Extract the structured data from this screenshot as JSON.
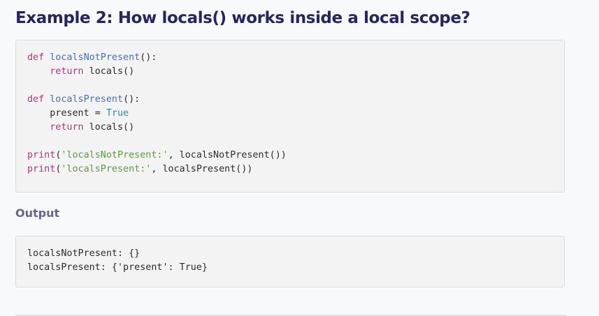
{
  "heading": {
    "title": "Example 2: How locals() works inside a local scope?"
  },
  "source_code": {
    "lines": [
      [
        {
          "t": "def ",
          "c": "kw"
        },
        {
          "t": "localsNotPresent",
          "c": "fn"
        },
        {
          "t": "():",
          "c": "pl"
        }
      ],
      [
        {
          "t": "    ",
          "c": "pl"
        },
        {
          "t": "return",
          "c": "kw"
        },
        {
          "t": " locals()",
          "c": "pl"
        }
      ],
      [],
      [
        {
          "t": "def ",
          "c": "kw"
        },
        {
          "t": "localsPresent",
          "c": "fn"
        },
        {
          "t": "():",
          "c": "pl"
        }
      ],
      [
        {
          "t": "    present = ",
          "c": "pl"
        },
        {
          "t": "True",
          "c": "bi"
        }
      ],
      [
        {
          "t": "    ",
          "c": "pl"
        },
        {
          "t": "return",
          "c": "kw"
        },
        {
          "t": " locals()",
          "c": "pl"
        }
      ],
      [],
      [
        {
          "t": "print",
          "c": "kw"
        },
        {
          "t": "(",
          "c": "pl"
        },
        {
          "t": "'localsNotPresent:'",
          "c": "str"
        },
        {
          "t": ", localsNotPresent())",
          "c": "pl"
        }
      ],
      [
        {
          "t": "print",
          "c": "kw"
        },
        {
          "t": "(",
          "c": "pl"
        },
        {
          "t": "'localsPresent:'",
          "c": "str"
        },
        {
          "t": ", localsPresent())",
          "c": "pl"
        }
      ]
    ]
  },
  "output_section": {
    "heading": "Output",
    "lines": [
      "localsNotPresent: {}",
      "localsPresent: {'present': True}"
    ]
  },
  "colors": {
    "title": "#25265e",
    "subheading": "#65678a",
    "keyword": "#b5317f",
    "function_name": "#3b72c7",
    "string": "#5a9e3a",
    "builtin_constant": "#2a8aa6",
    "code_text": "#2b2b2b",
    "code_background": "#f3f3f3",
    "page_background": "#f8f9fa"
  }
}
